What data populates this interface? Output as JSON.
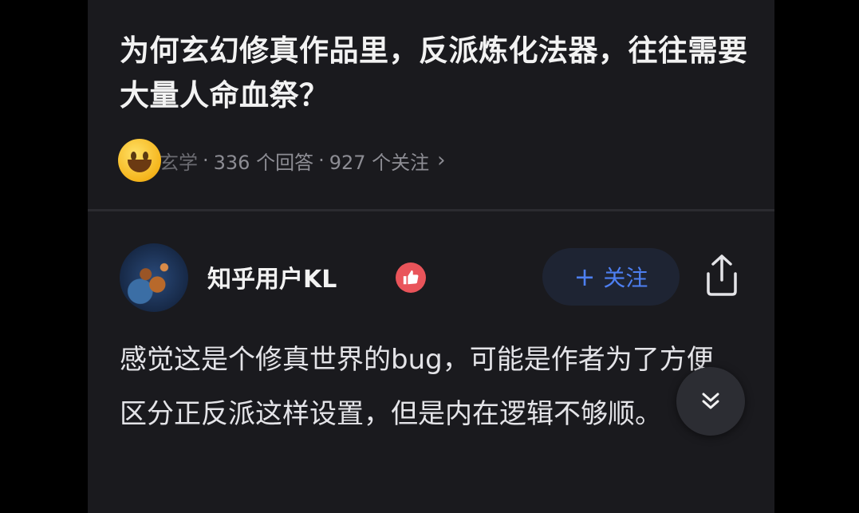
{
  "question": {
    "title": "为何玄幻修真作品里，反派炼化法器，往往需要大量人命血祭？",
    "topic_partial": "玄学",
    "answers_count": "336 个回答",
    "followers_count": "927 个关注",
    "separator": "·",
    "more_chevron": "›"
  },
  "answer": {
    "author_name": "知乎用户KL",
    "follow_label": "关注",
    "follow_plus": "+",
    "content": "感觉这是个修真世界的bug，可能是作者为了方便区分正反派这样设置，但是内在逻辑不够顺。"
  },
  "icons": {
    "emoji": "grinning-face-icon",
    "badge": "thumbs-up-badge-icon",
    "share": "share-icon",
    "scroll": "double-chevron-down-icon"
  },
  "colors": {
    "background": "#1a1a1e",
    "accent": "#4d7ff2",
    "follow_bg": "#1e2433",
    "badge": "#e9545a",
    "text_primary": "#f2f2f2",
    "text_secondary": "#8d8d94"
  }
}
